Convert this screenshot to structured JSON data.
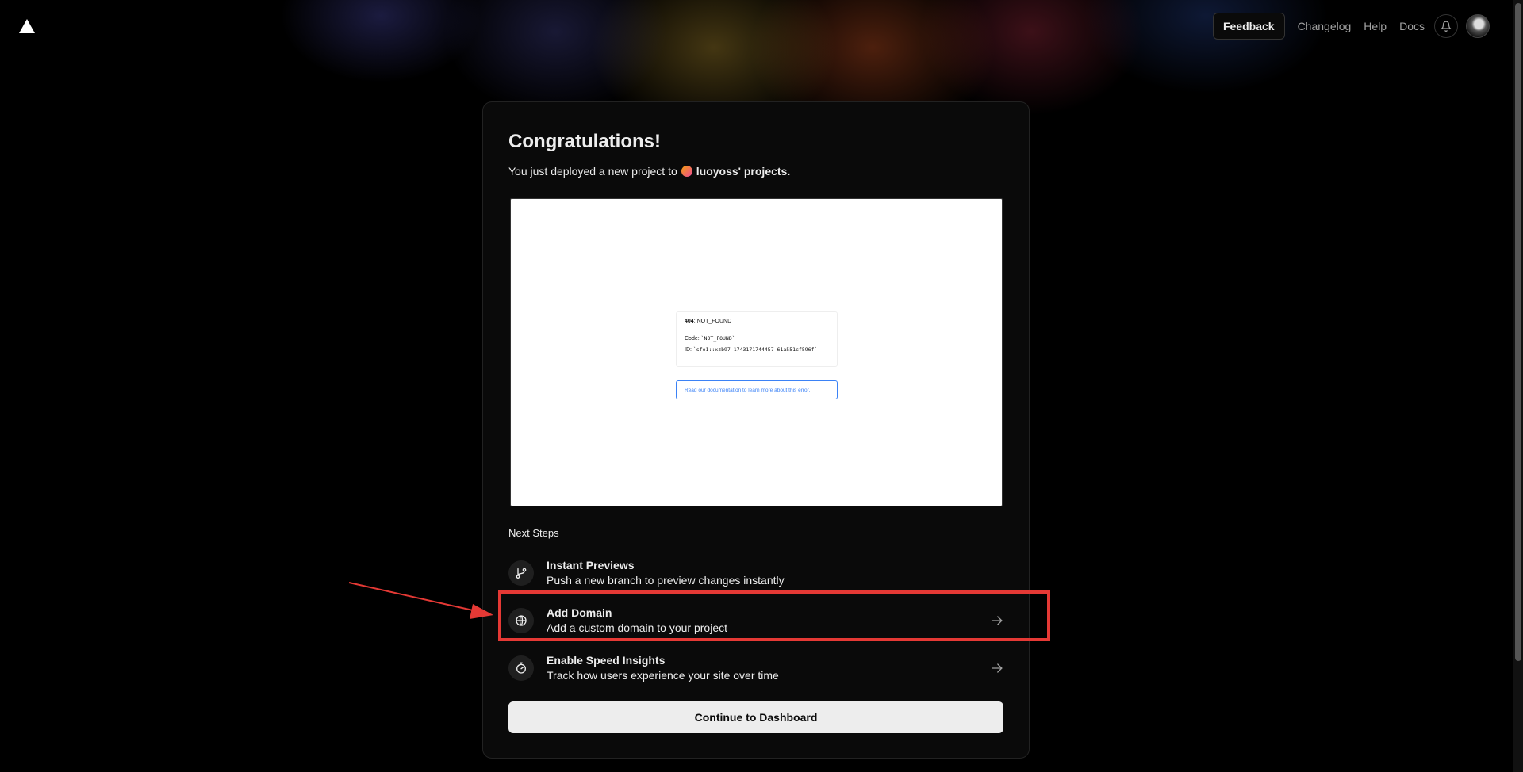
{
  "header": {
    "logo_icon": "vercel-triangle-icon",
    "feedback_label": "Feedback",
    "links": [
      "Changelog",
      "Help",
      "Docs"
    ],
    "notifications_icon": "bell-icon",
    "avatar_icon": "user-avatar"
  },
  "card": {
    "title": "Congratulations!",
    "subtitle_prefix": "You just deployed a new project to",
    "team_name": "luoyoss' projects."
  },
  "preview": {
    "error_code": "404",
    "error_name": ": NOT_FOUND",
    "code_label": "Code: ",
    "code_value": "`NOT_FOUND`",
    "id_label": "ID: ",
    "id_value": "`sfo1::xzb97-1743171744457-61a551cf596f`",
    "doc_link": "Read our documentation to learn more about this error."
  },
  "next_steps": {
    "heading": "Next Steps",
    "items": [
      {
        "title": "Instant Previews",
        "description": "Push a new branch to preview changes instantly",
        "icon": "git-branch-icon",
        "arrow": false
      },
      {
        "title": "Add Domain",
        "description": "Add a custom domain to your project",
        "icon": "globe-icon",
        "arrow": true
      },
      {
        "title": "Enable Speed Insights",
        "description": "Track how users experience your site over time",
        "icon": "speed-gauge-icon",
        "arrow": true
      }
    ]
  },
  "continue_label": "Continue to Dashboard",
  "colors": {
    "background": "#000000",
    "card": "#0a0a0a",
    "highlight": "#e53935",
    "link_blue": "#3b82f6"
  }
}
